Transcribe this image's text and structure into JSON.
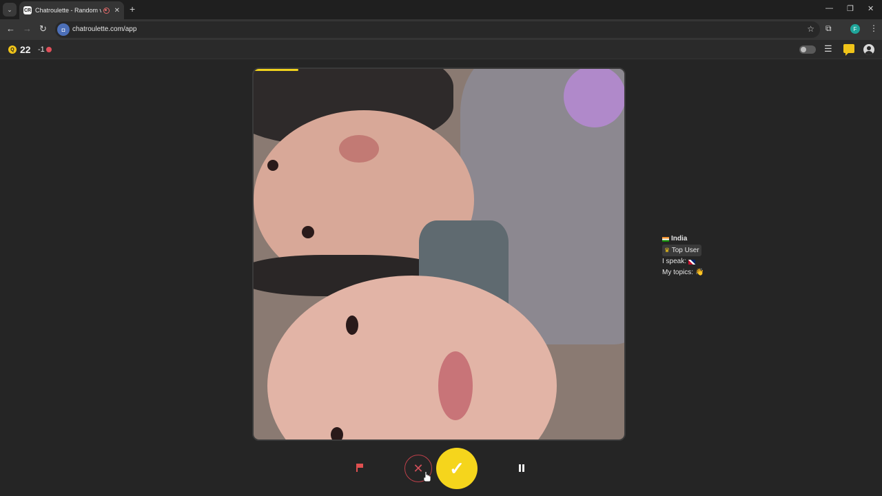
{
  "browser": {
    "tab_title": "Chatroulette - Random vid",
    "favicon_text": "CR",
    "url": "chatroulette.com/app",
    "profile_initial": "F"
  },
  "header": {
    "coin_symbol": "Q",
    "coins": "22",
    "delta": "-1"
  },
  "video": {
    "countdown_progress": 0.12
  },
  "partner": {
    "country": "India",
    "status": "Top User",
    "speak_label": "I speak:",
    "topics_label": "My topics:",
    "topics_emoji": "👋"
  },
  "colors": {
    "accent": "#f5d51c",
    "danger": "#d0505a"
  },
  "icons": {
    "report": "flag-icon",
    "skip": "close-icon",
    "accept": "check-icon",
    "pause": "pause-icon"
  }
}
